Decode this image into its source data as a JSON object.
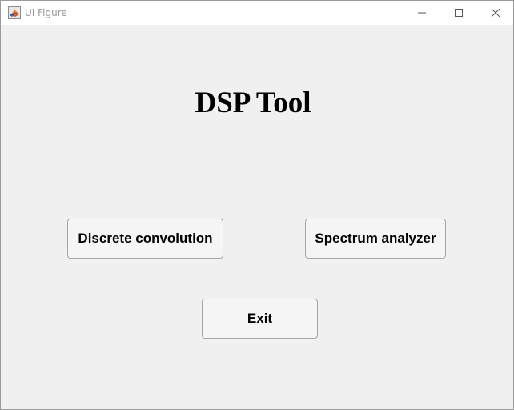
{
  "window": {
    "title": "UI Figure",
    "icon": "matlab-icon",
    "controls": {
      "minimize": "minimize-icon",
      "maximize": "maximize-icon",
      "close": "close-icon"
    }
  },
  "app": {
    "title": "DSP Tool",
    "buttons": {
      "discrete_convolution": "Discrete convolution",
      "spectrum_analyzer": "Spectrum analyzer",
      "exit": "Exit"
    }
  },
  "colors": {
    "background": "#f0f0f0",
    "titlebar": "#ffffff",
    "button_face": "#f5f5f5",
    "button_border": "#a6a6a6"
  }
}
